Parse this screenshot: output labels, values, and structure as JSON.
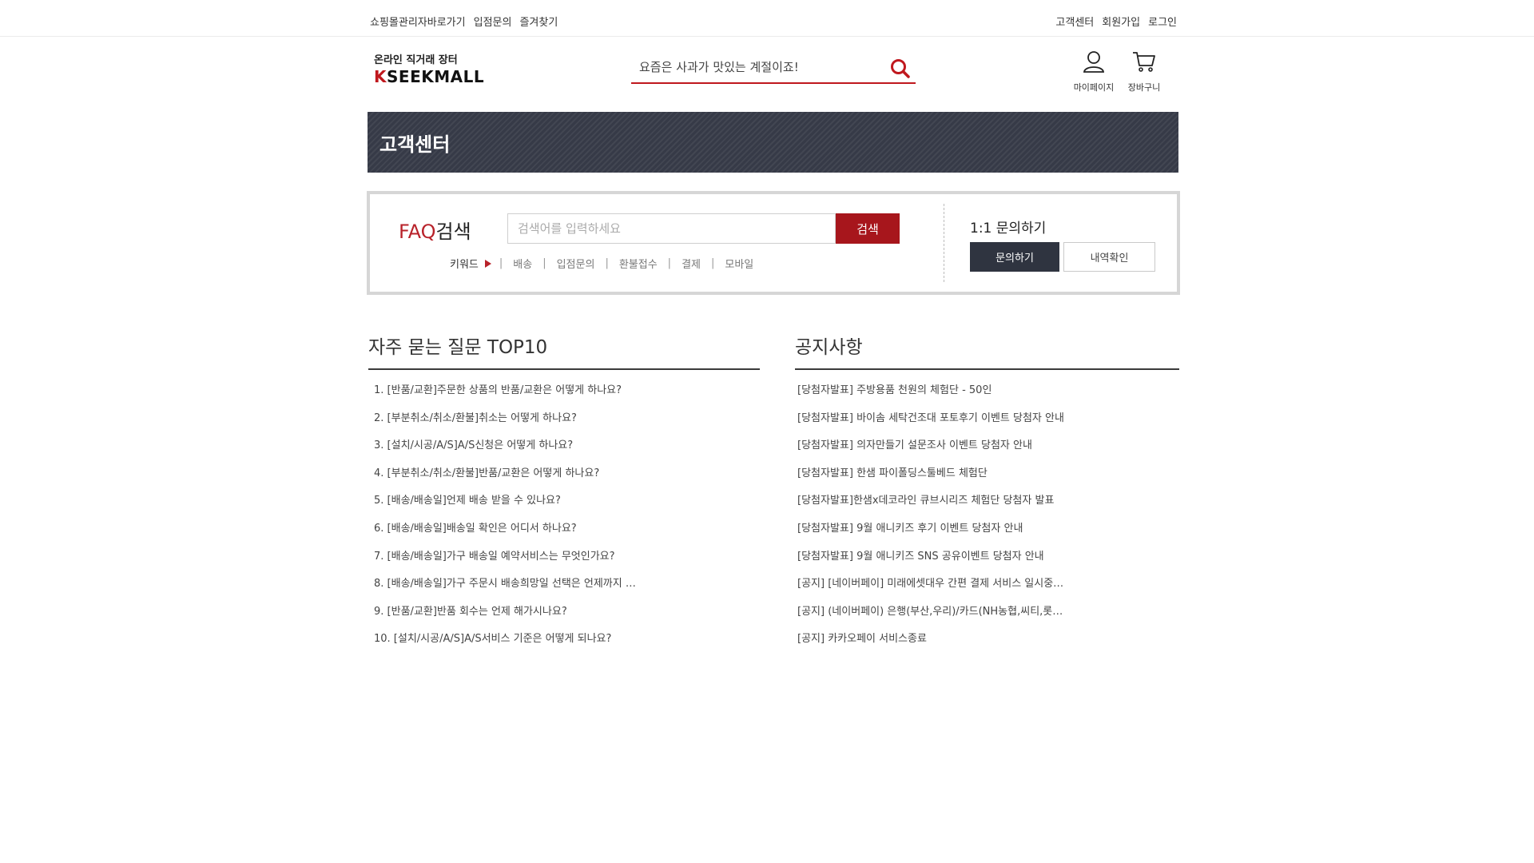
{
  "topbar": {
    "left": [
      "쇼핑몰관리자바로가기",
      "입점문의",
      "즐겨찾기"
    ],
    "right": [
      "고객센터",
      "회원가입",
      "로그인"
    ]
  },
  "logo": {
    "tagline": "온라인 직거래 장터",
    "name_k": "K",
    "name_rest": "SEEKMALL"
  },
  "search": {
    "placeholder": "요즘은 사과가 맛있는 계절이죠!"
  },
  "header_icons": {
    "mypage": "마이페이지",
    "cart": "장바구니"
  },
  "banner": {
    "title": "고객센터"
  },
  "faq_search": {
    "title_red": "FAQ",
    "title_rest": "검색",
    "placeholder": "검색어를 입력하세요",
    "button": "검색",
    "keywords_label": "키워드",
    "keywords": [
      "배송",
      "입점문의",
      "환불접수",
      "결제",
      "모바일"
    ]
  },
  "inquiry": {
    "title": "1:1 문의하기",
    "button_ask": "문의하기",
    "button_history": "내역확인"
  },
  "faq_top10": {
    "title": "자주 묻는 질문 TOP10",
    "items": [
      "1. [반품/교환]주문한 상품의 반품/교환은 어떻게 하나요?",
      "2. [부분취소/취소/환불]취소는 어떻게 하나요?",
      "3. [설치/시공/A/S]A/S신청은 어떻게 하나요?",
      "4. [부분취소/취소/환불]반품/교환은 어떻게 하나요?",
      "5. [배송/배송일]언제 배송 받을 수 있나요?",
      "6. [배송/배송일]배송일 확인은 어디서 하나요?",
      "7. [배송/배송일]가구 배송일 예약서비스는 무엇인가요?",
      "8. [배송/배송일]가구 주문시 배송희망일 선택은 언제까지 …",
      "9. [반품/교환]반품 회수는 언제 해가시나요?",
      "10. [설치/시공/A/S]A/S서비스 기준은 어떻게 되나요?"
    ]
  },
  "notices": {
    "title": "공지사항",
    "items": [
      "[당첨자발표] 주방용품 천원의 체험단 - 50인",
      "[당첨자발표] 바이솜 세탁건조대 포토후기 이벤트 당첨자 안내",
      "[당첨자발표] 의자만들기 설문조사 이벤트 당첨자 안내",
      "[당첨자발표] 한샘 파이폴딩스툴베드 체험단",
      "[당첨자발표]한샘x데코라인 큐브시리즈 체험단 당첨자 발표",
      "[당첨자발표] 9월 애니키즈 후기 이벤트 당첨자 안내",
      "[당첨자발표] 9월 애니키즈 SNS 공유이벤트 당첨자 안내",
      "[공지] [네이버페이] 미래에셋대우 간편 결제 서비스 일시중…",
      "[공지] (네이버페이) 은행(부산,우리)/카드(NH농협,씨티,롯…",
      "[공지] 카카오페이 서비스종료"
    ]
  },
  "colors": {
    "accent": "#b8222a",
    "banner": "#363a47",
    "dark_button": "#2f3440"
  },
  "icons": {
    "search": "search-icon",
    "mypage": "user-icon",
    "cart": "cart-icon",
    "keyword_arrow": "triangle-right-icon"
  }
}
